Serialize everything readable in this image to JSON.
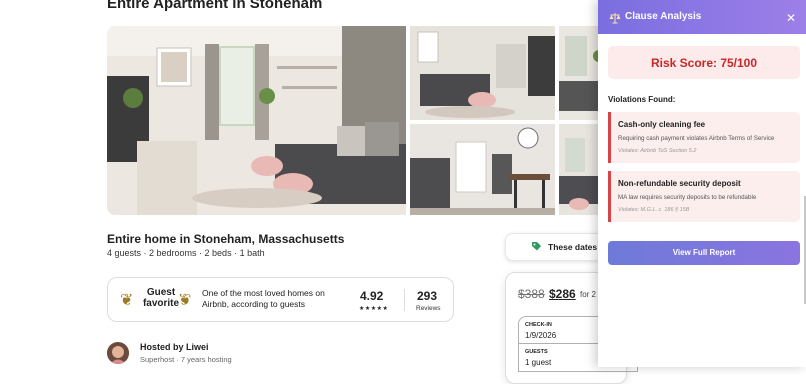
{
  "listing": {
    "page_title": "Entire Apartment in Stoneham",
    "title": "Entire home in Stoneham, Massachusetts",
    "details": "4 guests · 2 bedrooms · 2 beds · 1 bath"
  },
  "guest_favorite": {
    "label_line1": "Guest",
    "label_line2": "favorite",
    "description": "One of the most loved homes on Airbnb, according to guests",
    "rating": "4.92",
    "stars": "★★★★★",
    "reviews_count": "293",
    "reviews_label": "Reviews"
  },
  "host": {
    "name": "Hosted by Liwei",
    "meta": "Superhost · 7 years hosting"
  },
  "booking": {
    "dates_banner": "These dates a",
    "price_old": "$388",
    "price_new": "$286",
    "price_suffix": "for 2",
    "checkin_label": "CHECK-IN",
    "checkin_value": "1/9/2026",
    "guests_label": "GUESTS",
    "guests_value": "1 guest"
  },
  "panel": {
    "title": "Clause Analysis",
    "close_symbol": "✕",
    "risk_score": "Risk Score: 75/100",
    "violations_label": "Violations Found:",
    "violations": [
      {
        "title": "Cash-only cleaning fee",
        "description": "Requiring cash payment violates Airbnb Terms of Service",
        "law": "Violates: Airbnb ToS Section 5.2"
      },
      {
        "title": "Non-refundable security deposit",
        "description": "MA law requires security deposits to be refundable",
        "law": "Violates: M.G.L. c. 186 § 15B"
      }
    ],
    "report_button": "View Full Report"
  },
  "colors": {
    "panel_header": "#7a6ee0",
    "risk_text": "#c62828",
    "violation_border": "#d64545",
    "button": "#6e7ad8"
  },
  "icons": [
    "scale-icon",
    "close-icon",
    "tag-icon",
    "laurel-left-icon",
    "laurel-right-icon"
  ]
}
